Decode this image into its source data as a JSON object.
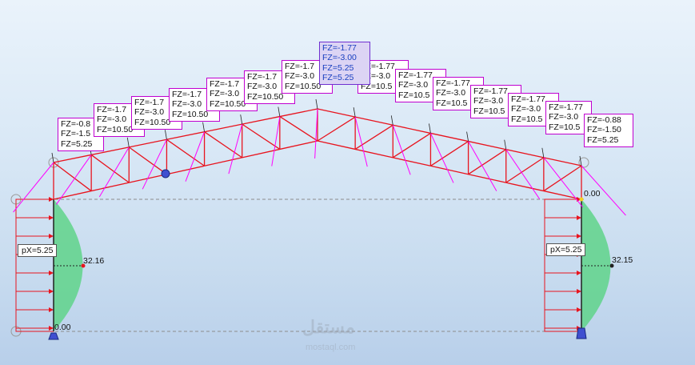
{
  "labels": [
    {
      "lines": [
        "FZ=-0.8",
        "FZ=-1.5",
        "FZ=5.25"
      ]
    },
    {
      "lines": [
        "FZ=-1.7",
        "FZ=-3.0",
        "FZ=10.50"
      ]
    },
    {
      "lines": [
        "FZ=-1.7",
        "FZ=-3.0",
        "FZ=10.50"
      ]
    },
    {
      "lines": [
        "FZ=-1.7",
        "FZ=-3.0",
        "FZ=10.50"
      ]
    },
    {
      "lines": [
        "FZ=-1.7",
        "FZ=-3.0",
        "FZ=10.50"
      ]
    },
    {
      "lines": [
        "FZ=-1.7",
        "FZ=-3.0",
        "FZ=10.50"
      ]
    },
    {
      "lines": [
        "FZ=-1.7",
        "FZ=-3.0",
        "FZ=10.50"
      ]
    },
    {
      "lines": [
        "FZ=-1.77",
        "FZ=-3.00",
        "FZ=5.25",
        "FZ=5.25"
      ]
    },
    {
      "lines": [
        "FZ=-1.77",
        "FZ=-3.0",
        "FZ=10.5"
      ]
    },
    {
      "lines": [
        "FZ=-1.77",
        "FZ=-3.0",
        "FZ=10.5"
      ]
    },
    {
      "lines": [
        "FZ=-1.77",
        "FZ=-3.0",
        "FZ=10.5"
      ]
    },
    {
      "lines": [
        "FZ=-1.77",
        "FZ=-3.0",
        "FZ=10.5"
      ]
    },
    {
      "lines": [
        "FZ=-1.77",
        "FZ=-3.0",
        "FZ=10.5"
      ]
    },
    {
      "lines": [
        "FZ=-1.77",
        "FZ=-3.0",
        "FZ=10.5"
      ]
    },
    {
      "lines": [
        "FZ=-0.88",
        "FZ=-1.50",
        "FZ=5.25"
      ]
    }
  ],
  "left_column": {
    "px_label": "pX=5.25",
    "max_value": "32.16",
    "base_value": "0.00"
  },
  "right_column": {
    "px_label": "pX=5.25",
    "max_value": "32.15",
    "top_value": "0.00"
  },
  "watermark": {
    "main": "مستقل",
    "sub": "mostaql.com"
  },
  "colors": {
    "truss": "#e8141e",
    "loads": "#ff00ff",
    "diagram": "#5fd38a",
    "selected_label": "#dcd4f4"
  }
}
